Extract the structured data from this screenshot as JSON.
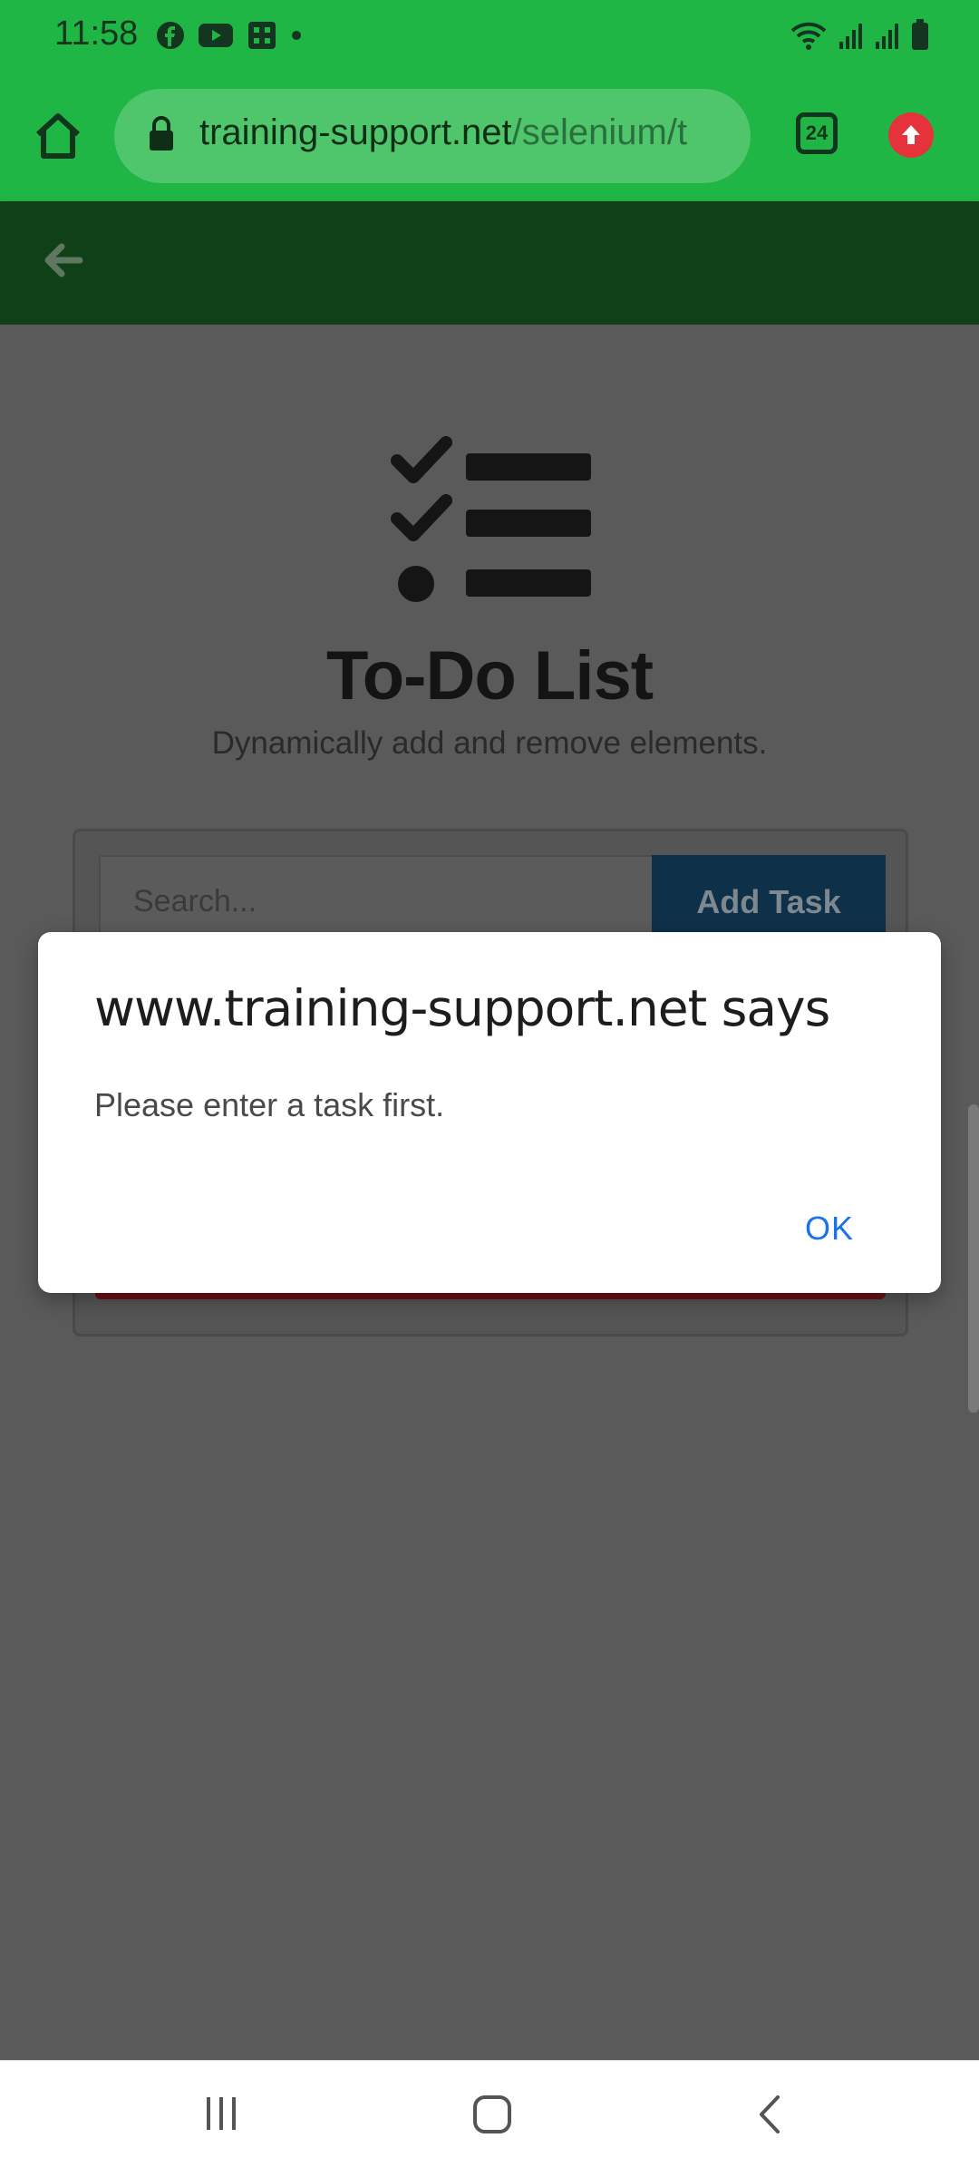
{
  "status_bar": {
    "time": "11:58",
    "left_icons": [
      "facebook-icon",
      "youtube-icon",
      "app-icon",
      "notification-dot-icon"
    ],
    "right_icons": [
      "wifi-icon",
      "signal-icon",
      "signal-icon",
      "battery-icon"
    ]
  },
  "browser": {
    "url_domain": "training-support.net",
    "url_path": "/selenium/t",
    "tab_count": "24",
    "theme_color": "#20b646"
  },
  "page": {
    "header_color": "#0f4018",
    "title": "To-Do List",
    "subtitle": "Dynamically add and remove elements.",
    "input_placeholder": "Search...",
    "add_button_label": "Add Task"
  },
  "dialog": {
    "title": "www.training-support.net says",
    "message": "Please enter a task first.",
    "ok_label": "OK"
  },
  "nav_bar": {
    "buttons": [
      "recent-apps-icon",
      "home-icon",
      "back-icon"
    ]
  }
}
